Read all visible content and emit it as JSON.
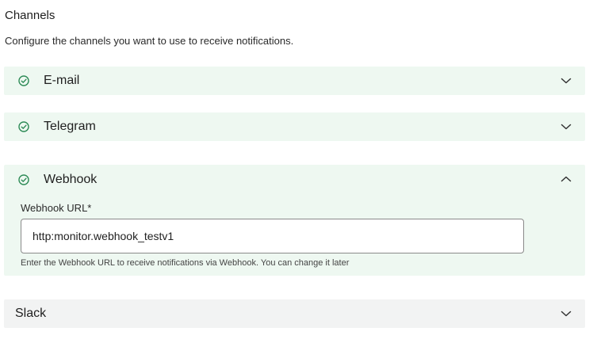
{
  "section": {
    "title": "Channels",
    "description": "Configure the channels you want to use to receive notifications."
  },
  "channels": [
    {
      "label": "E-mail",
      "enabled": true,
      "expanded": false,
      "icon": "check-circle-icon"
    },
    {
      "label": "Telegram",
      "enabled": true,
      "expanded": false,
      "icon": "check-circle-icon"
    },
    {
      "label": "Webhook",
      "enabled": true,
      "expanded": true,
      "icon": "check-circle-icon",
      "field": {
        "label": "Webhook URL*",
        "value": "http:monitor.webhook_testv1",
        "help": "Enter the Webhook URL to receive notifications via Webhook. You can change it later"
      }
    },
    {
      "label": "Slack",
      "enabled": false,
      "expanded": false
    }
  ],
  "colors": {
    "enabled_bg": "#eef8f1",
    "disabled_bg": "#f2f3f3",
    "check_icon": "#2e8b57",
    "chevron": "#333333"
  }
}
